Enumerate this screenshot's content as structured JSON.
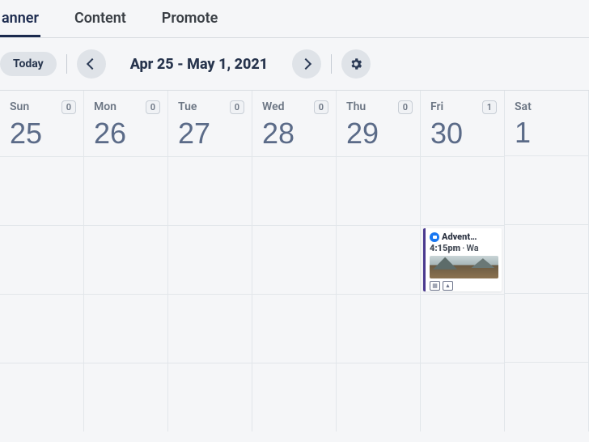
{
  "tabs": [
    {
      "label": "anner",
      "active": true
    },
    {
      "label": "Content",
      "active": false
    },
    {
      "label": "Promote",
      "active": false
    }
  ],
  "toolbar": {
    "today_label": "Today",
    "date_range": "Apr 25 - May 1, 2021"
  },
  "days": [
    {
      "name": "Sun",
      "num": "25",
      "count": "0"
    },
    {
      "name": "Mon",
      "num": "26",
      "count": "0"
    },
    {
      "name": "Tue",
      "num": "27",
      "count": "0"
    },
    {
      "name": "Wed",
      "num": "28",
      "count": "0"
    },
    {
      "name": "Thu",
      "num": "29",
      "count": "0"
    },
    {
      "name": "Fri",
      "num": "30",
      "count": "1"
    },
    {
      "name": "Sat",
      "num": "1",
      "count": ""
    }
  ],
  "event": {
    "title": "Advent…",
    "time": "4:15pm",
    "sep": "·",
    "text": "Wa",
    "accent_color": "#4b3a8f",
    "platform_icon": "facebook",
    "footer_icons": [
      "calendar",
      "image"
    ]
  }
}
